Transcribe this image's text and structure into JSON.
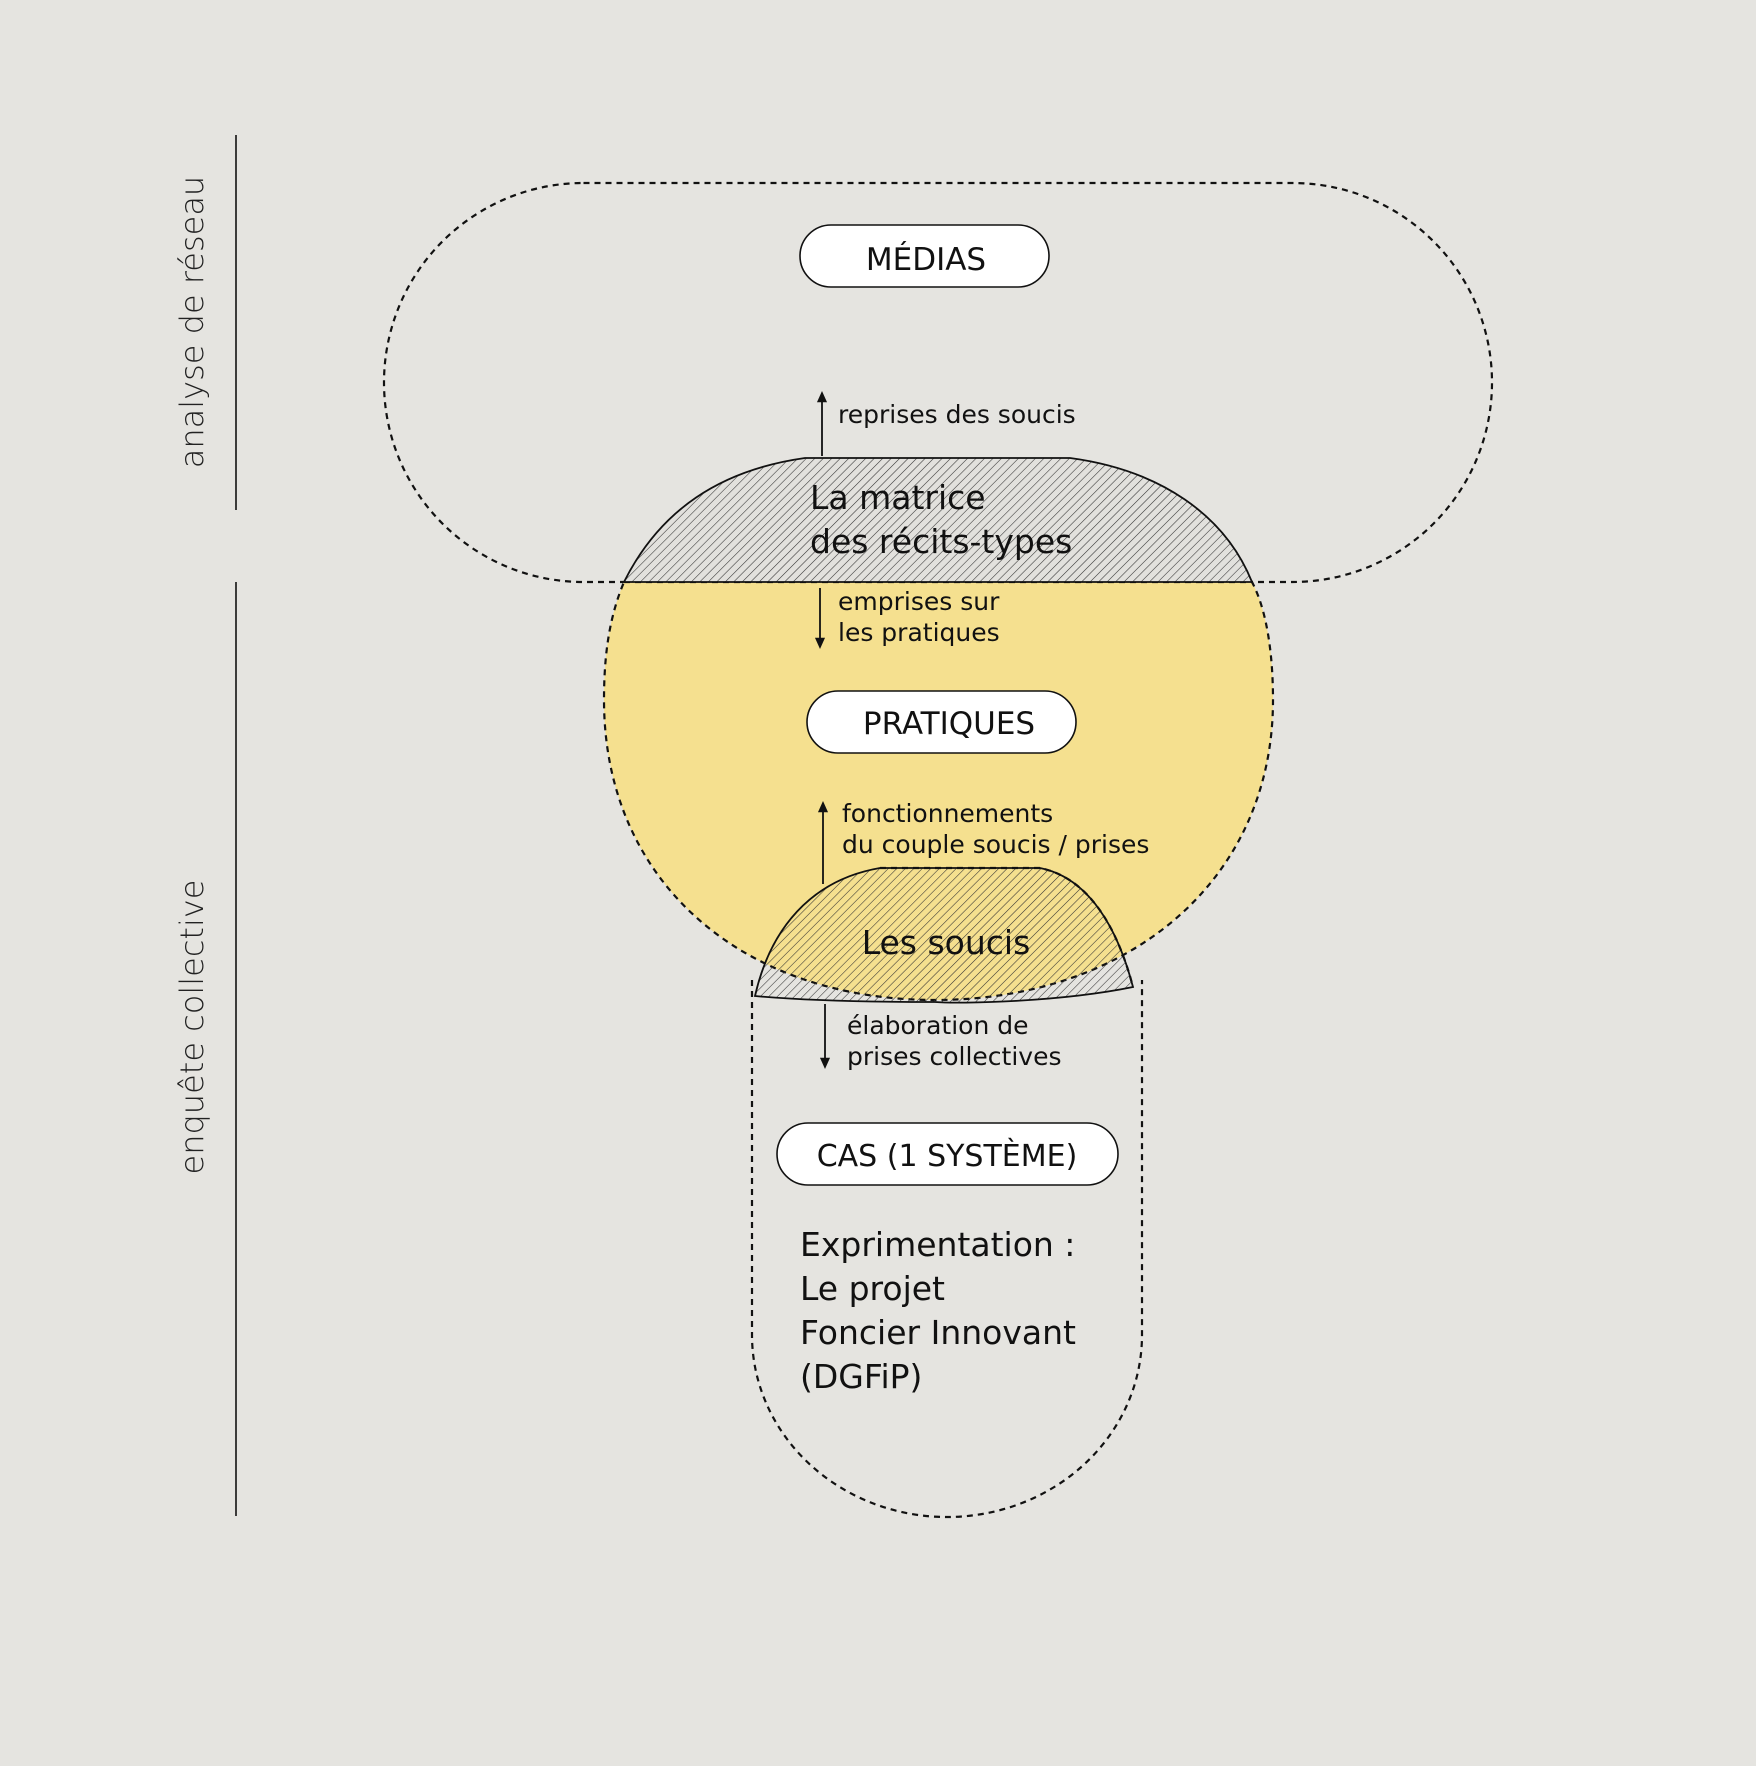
{
  "colors": {
    "background": "#e5e4e0",
    "ink": "#111111",
    "practices_fill": "#f5e08f",
    "pill_fill": "#ffffff"
  },
  "side_labels": {
    "network": "analyse de réseau",
    "collective": "enquête collective"
  },
  "pills": {
    "medias": "MÉDIAS",
    "pratiques": "PRATIQUES",
    "cas": "CAS (1 SYSTÈME)"
  },
  "zones": {
    "matrice_line1": "La matrice",
    "matrice_line2": "des récits-types",
    "soucis": "Les soucis"
  },
  "arrows": {
    "reprises": "reprises des soucis",
    "emprises_line1": "emprises sur",
    "emprises_line2": "les pratiques",
    "fonctionnements_line1": "fonctionnements",
    "fonctionnements_line2": "du couple soucis / prises",
    "elaboration_line1": "élaboration de",
    "elaboration_line2": "prises collectives"
  },
  "case_text": {
    "line1": "Exprimentation :",
    "line2": "Le projet",
    "line3": "Foncier Innovant",
    "line4": "(DGFiP)"
  }
}
